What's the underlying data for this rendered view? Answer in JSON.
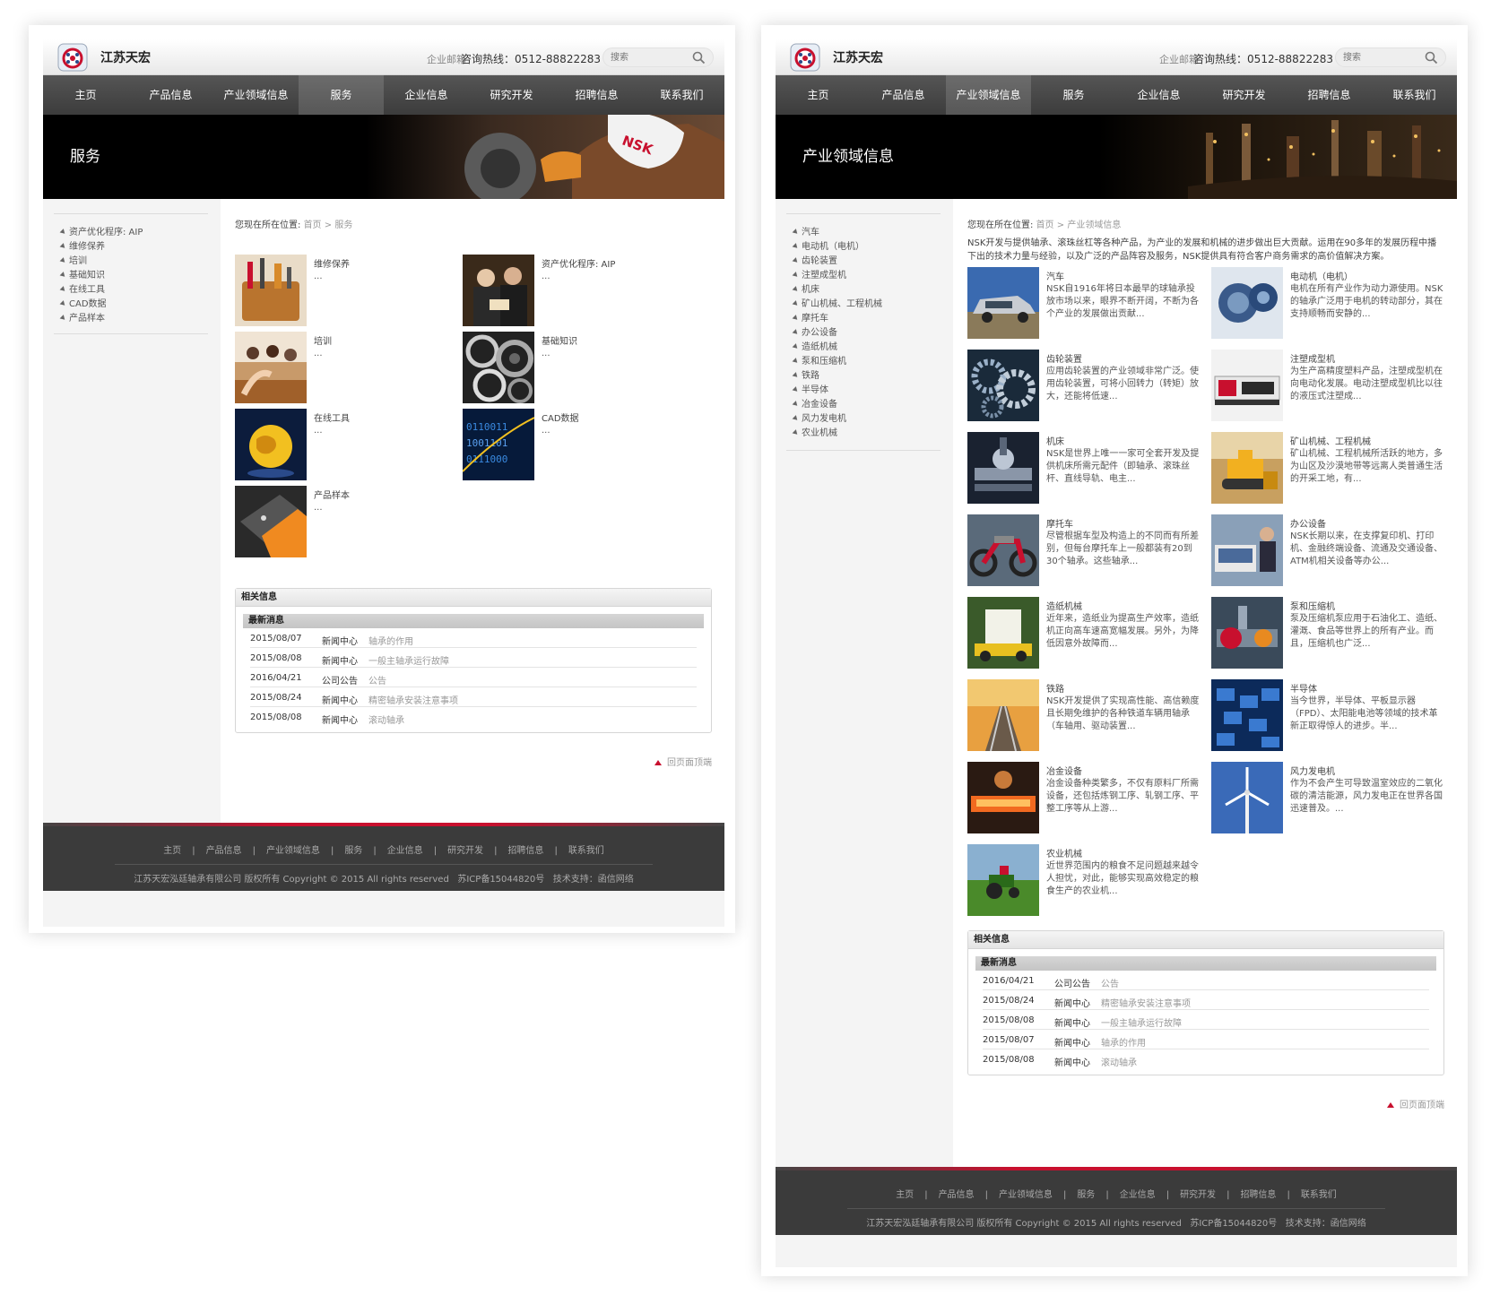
{
  "common": {
    "brand": "江苏天宏",
    "mail_label": "企业邮箱",
    "hotline": "咨询热线：0512-88822283",
    "search_placeholder": "搜索",
    "nav": [
      "主页",
      "产品信息",
      "产业领域信息",
      "服务",
      "企业信息",
      "研究开发",
      "招聘信息",
      "联系我们"
    ],
    "crumb_prefix": "您现在所在位置:",
    "crumb_home": "首页",
    "crumb_sep": ">",
    "related_title": "相关信息",
    "related_sub": "最新消息",
    "back_top": "回页面顶端",
    "footer_links": [
      "主页",
      "产品信息",
      "产业领域信息",
      "服务",
      "企业信息",
      "研究开发",
      "招聘信息",
      "联系我们"
    ],
    "footer_sep": "|",
    "copyright": "江苏天宏泓廷轴承有限公司 版权所有 Copyright © 2015 All rights reserved",
    "icp": "苏ICP备15044820号",
    "support": "技术支持：函信网络",
    "colors": {
      "nav_bg": "#444444",
      "accent_red": "#c8102e",
      "footer_bg": "#3b3b3b"
    }
  },
  "left": {
    "banner_title": "服务",
    "crumb_current": "服务",
    "sidebar": [
      "资产优化程序: AIP",
      "维修保养",
      "培训",
      "基础知识",
      "在线工具",
      "CAD数据",
      "产品样本"
    ],
    "cards": [
      {
        "title": "维修保养",
        "desc": "...",
        "icon": "toolbag-photo"
      },
      {
        "title": "资产优化程序: AIP",
        "desc": "...",
        "icon": "meeting-photo"
      },
      {
        "title": "培训",
        "desc": "...",
        "icon": "classroom-photo"
      },
      {
        "title": "基础知识",
        "desc": "...",
        "icon": "bearings-photo"
      },
      {
        "title": "在线工具",
        "desc": "...",
        "icon": "globe-photo"
      },
      {
        "title": "CAD数据",
        "desc": "...",
        "icon": "binary-photo"
      },
      {
        "title": "产品样本",
        "desc": "...",
        "icon": "catalog-photo"
      }
    ],
    "news": [
      {
        "date": "2015/08/07",
        "cat": "新闻中心",
        "title": "轴承的作用"
      },
      {
        "date": "2015/08/08",
        "cat": "新闻中心",
        "title": "一般主轴承运行故障"
      },
      {
        "date": "2016/04/21",
        "cat": "公司公告",
        "title": "公告"
      },
      {
        "date": "2015/08/24",
        "cat": "新闻中心",
        "title": "精密轴承安装注意事项"
      },
      {
        "date": "2015/08/08",
        "cat": "新闻中心",
        "title": "滚动轴承"
      }
    ]
  },
  "right": {
    "banner_title": "产业领域信息",
    "crumb_current": "产业领域信息",
    "intro": "NSK开发与提供轴承、滚珠丝杠等各种产品，为产业的发展和机械的进步做出巨大贡献。运用在90多年的发展历程中播下出的技术力量与经验，以及广泛的产品阵容及服务，NSK提供具有符合客户商务需求的高价值解决方案。",
    "sidebar": [
      "汽车",
      "电动机（电机）",
      "齿轮装置",
      "注塑成型机",
      "机床",
      "矿山机械、工程机械",
      "摩托车",
      "办公设备",
      "造纸机械",
      "泵和压缩机",
      "铁路",
      "半导体",
      "冶金设备",
      "风力发电机",
      "农业机械"
    ],
    "cards": [
      {
        "title": "汽车",
        "desc": "NSK自1916年将日本最早的球轴承投放市场以来，眼界不断开阔，不断为各个产业的发展做出贡献...",
        "icon": "car-photo"
      },
      {
        "title": "电动机（电机）",
        "desc": "电机在所有产业作为动力源使用。NSK的轴承广泛用于电机的转动部分，其在支持顺畅而安静的...",
        "icon": "motor-photo"
      },
      {
        "title": "齿轮装置",
        "desc": "应用齿轮装置的产业领域非常广泛。使用齿轮装置，可将小回转力（转矩）放大，还能将低速...",
        "icon": "gears-photo"
      },
      {
        "title": "注塑成型机",
        "desc": "为生产高精度塑料产品，注塑成型机在向电动化发展。电动注塑成型机比以往的液压式注塑成...",
        "icon": "molding-machine-photo"
      },
      {
        "title": "机床",
        "desc": "NSK是世界上唯一一家可全套开发及提供机床所需元配件（即轴承、滚珠丝杆、直线导轨、电主...",
        "icon": "machine-tool-photo"
      },
      {
        "title": "矿山机械、工程机械",
        "desc": "矿山机械、工程机械所活跃的地方，多为山区及沙漠地带等远离人类普通生活的开采工地，有...",
        "icon": "bulldozer-photo"
      },
      {
        "title": "摩托车",
        "desc": "尽管根据车型及构造上的不同而有所差别，但每台摩托车上一般都装有20到30个轴承。这些轴承...",
        "icon": "motorcycle-photo"
      },
      {
        "title": "办公设备",
        "desc": "NSK长期以来，在支撑复印机、打印机、金融终端设备、流通及交通设备、ATM机相关设备等办公...",
        "icon": "office-photo"
      },
      {
        "title": "造纸机械",
        "desc": "近年来，造纸业为提高生产效率，造纸机正向高车速高宽幅发展。另外，为降低因意外故障而...",
        "icon": "paper-machine-photo"
      },
      {
        "title": "泵和压缩机",
        "desc": "泵及压缩机泵应用于石油化工、造纸、灌溉、食品等世界上的所有产业。而且，压缩机也广泛...",
        "icon": "pump-photo"
      },
      {
        "title": "铁路",
        "desc": "NSK开发提供了实现高性能、高信赖度且长期免维护的各种铁道车辆用轴承（车轴用、驱动装置...",
        "icon": "railway-photo"
      },
      {
        "title": "半导体",
        "desc": "当今世界，半导体、平板显示器（FPD）、太阳能电池等领域的技术革新正取得惊人的进步。半...",
        "icon": "semiconductor-photo"
      },
      {
        "title": "冶金设备",
        "desc": "冶金设备种类繁多，不仅有原料厂所需设备，还包括炼钢工序、轧钢工序、平整工序等从上游...",
        "icon": "steel-photo"
      },
      {
        "title": "风力发电机",
        "desc": "作为不会产生可导致温室效应的二氧化碳的清洁能源，风力发电正在世界各国迅速普及。...",
        "icon": "wind-turbine-photo"
      },
      {
        "title": "农业机械",
        "desc": "近世界范围内的粮食不足问题越来越令人担忧，对此，能够实现高效稳定的粮食生产的农业机...",
        "icon": "tractor-photo"
      }
    ],
    "news": [
      {
        "date": "2016/04/21",
        "cat": "公司公告",
        "title": "公告"
      },
      {
        "date": "2015/08/24",
        "cat": "新闻中心",
        "title": "精密轴承安装注意事项"
      },
      {
        "date": "2015/08/08",
        "cat": "新闻中心",
        "title": "一般主轴承运行故障"
      },
      {
        "date": "2015/08/07",
        "cat": "新闻中心",
        "title": "轴承的作用"
      },
      {
        "date": "2015/08/08",
        "cat": "新闻中心",
        "title": "滚动轴承"
      }
    ]
  }
}
